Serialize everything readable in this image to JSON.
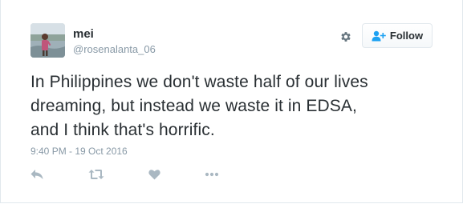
{
  "user": {
    "name": "mei",
    "handle": "@rosenalanta_06"
  },
  "header": {
    "follow_label": "Follow",
    "settings_icon": "gear-icon",
    "follow_icon": "add-user-icon"
  },
  "tweet": {
    "lines": [
      "In Philippines we don't waste half of our lives",
      "dreaming, but instead we waste it in EDSA,",
      "and I think that's horrific."
    ],
    "timestamp": "9:40 PM - 19 Oct 2016"
  },
  "actions": [
    "reply-icon",
    "retweet-icon",
    "like-icon",
    "more-icon"
  ],
  "colors": {
    "text": "#292f33",
    "muted": "#8899a6",
    "icon": "#aab8c2",
    "accent": "#1da1f2",
    "border": "#e1e8ed"
  }
}
